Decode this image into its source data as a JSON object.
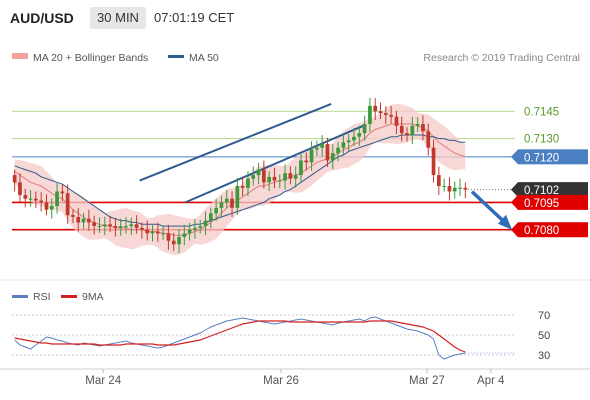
{
  "header": {
    "symbol": "AUD/USD",
    "timeframe": "30 MIN",
    "time": "07:01:19 CET"
  },
  "legend": {
    "ma20_bollinger": "MA 20 + Bollinger Bands",
    "ma50": "MA 50",
    "copyright": "Research © 2019 Trading Central"
  },
  "rsi_legend": {
    "rsi": "RSI",
    "ma9": "9MA"
  },
  "colors": {
    "bull": "#3a9a3a",
    "bear": "#c0392b",
    "band": "#f6c9c9",
    "ma20": "#e07b7b",
    "ma50": "#2e5c8a",
    "trend": "#2f5b91",
    "green_level": "#b5d98a",
    "blue_level": "#4a7fc1",
    "red_level": "#e00000",
    "current": "#333333",
    "arrow": "#2f6db5",
    "rsi": "#5a7fc0",
    "rsi_ma": "#d42020"
  },
  "chart_data": [
    {
      "type": "candlestick",
      "title": "AUD/USD 30 MIN",
      "x_ticks": [
        "Mar 24",
        "Mar 26",
        "Mar 27",
        "Apr 4"
      ],
      "ylim": [
        0.7059,
        0.7166
      ],
      "levels": [
        {
          "label": "0.7145",
          "value": 0.7145,
          "style": "green"
        },
        {
          "label": "0.7130",
          "value": 0.713,
          "style": "green"
        },
        {
          "label": "0.7120",
          "value": 0.712,
          "style": "blue"
        },
        {
          "label": "0.7102",
          "value": 0.7102,
          "style": "current"
        },
        {
          "label": "0.7095",
          "value": 0.7095,
          "style": "red"
        },
        {
          "label": "0.7080",
          "value": 0.708,
          "style": "red"
        }
      ],
      "close": [
        0.7106,
        0.7099,
        0.7097,
        0.7097,
        0.7096,
        0.7095,
        0.7091,
        0.7093,
        0.7101,
        0.71,
        0.7088,
        0.7087,
        0.7084,
        0.7086,
        0.7084,
        0.7082,
        0.7082,
        0.7083,
        0.7082,
        0.7081,
        0.7082,
        0.7082,
        0.7083,
        0.7081,
        0.708,
        0.7078,
        0.7079,
        0.7078,
        0.7078,
        0.7074,
        0.7072,
        0.7076,
        0.7078,
        0.708,
        0.7081,
        0.7082,
        0.7085,
        0.7089,
        0.7092,
        0.7095,
        0.7097,
        0.7092,
        0.7104,
        0.7103,
        0.7108,
        0.711,
        0.7113,
        0.7106,
        0.7109,
        0.7107,
        0.7107,
        0.7111,
        0.7108,
        0.711,
        0.7118,
        0.7117,
        0.7124,
        0.7125,
        0.7127,
        0.7118,
        0.7122,
        0.7125,
        0.7128,
        0.7129,
        0.7131,
        0.7133,
        0.7138,
        0.7148,
        0.7145,
        0.7144,
        0.7143,
        0.7142,
        0.7137,
        0.7133,
        0.7132,
        0.7137,
        0.7138,
        0.7134,
        0.7125,
        0.711,
        0.7104,
        0.7104,
        0.7101,
        0.7103,
        0.7103,
        0.7102
      ],
      "ma20": [
        0.7112,
        0.711,
        0.7108,
        0.7106,
        0.7105,
        0.7104,
        0.7102,
        0.71,
        0.7098,
        0.7097,
        0.7094,
        0.7091,
        0.7089,
        0.7087,
        0.7085,
        0.7084,
        0.7083,
        0.7082,
        0.7082,
        0.7081,
        0.7081,
        0.7081,
        0.708,
        0.708,
        0.708,
        0.7079,
        0.7079,
        0.7079,
        0.7078,
        0.7078,
        0.7077,
        0.7077,
        0.7077,
        0.7078,
        0.7079,
        0.708,
        0.7082,
        0.7084,
        0.7086,
        0.7089,
        0.7092,
        0.7094,
        0.7096,
        0.7098,
        0.71,
        0.7102,
        0.7104,
        0.7104,
        0.7105,
        0.7106,
        0.7107,
        0.7108,
        0.7109,
        0.711,
        0.7111,
        0.7113,
        0.7115,
        0.7117,
        0.7118,
        0.7119,
        0.712,
        0.7122,
        0.7124,
        0.7125,
        0.7127,
        0.7128,
        0.713,
        0.7133,
        0.7135,
        0.7136,
        0.7137,
        0.7138,
        0.7138,
        0.7138,
        0.7138,
        0.7138,
        0.7137,
        0.7136,
        0.7134,
        0.7131,
        0.7128,
        0.7126,
        0.7124,
        0.7122,
        0.7121,
        0.712
      ],
      "ma50": [
        0.7115,
        0.7114,
        0.7113,
        0.7112,
        0.7111,
        0.7109,
        0.7108,
        0.7107,
        0.7106,
        0.7105,
        0.7103,
        0.7101,
        0.7099,
        0.7097,
        0.7095,
        0.7093,
        0.7091,
        0.7089,
        0.7087,
        0.7086,
        0.7085,
        0.7085,
        0.7084,
        0.7084,
        0.7083,
        0.7083,
        0.7083,
        0.7083,
        0.7082,
        0.7082,
        0.7082,
        0.7082,
        0.7082,
        0.7082,
        0.7083,
        0.7083,
        0.7084,
        0.7085,
        0.7086,
        0.7087,
        0.7088,
        0.7089,
        0.709,
        0.7091,
        0.7092,
        0.7093,
        0.7094,
        0.7095,
        0.7097,
        0.7098,
        0.7099,
        0.7101,
        0.7102,
        0.7104,
        0.7106,
        0.7108,
        0.711,
        0.7112,
        0.7114,
        0.7116,
        0.7118,
        0.712,
        0.7121,
        0.7123,
        0.7124,
        0.7125,
        0.7126,
        0.7127,
        0.7128,
        0.7129,
        0.713,
        0.7131,
        0.7131,
        0.7132,
        0.7132,
        0.7132,
        0.7132,
        0.7132,
        0.7131,
        0.7131,
        0.713,
        0.713,
        0.7129,
        0.7129,
        0.7128,
        0.7128
      ],
      "bb_width": 0.0011,
      "channel_upper": [
        [
          0.28,
          0.7107
        ],
        [
          0.7,
          0.7149
        ]
      ],
      "channel_lower": [
        [
          0.38,
          0.7095
        ],
        [
          0.77,
          0.7137
        ]
      ],
      "forecast_arrow": [
        [
          0.7102,
          "0.7102"
        ],
        [
          0.708,
          "0.7080"
        ]
      ]
    },
    {
      "type": "line",
      "title": "RSI",
      "ylim": [
        20,
        80
      ],
      "y_ticks": [
        70,
        50,
        30
      ],
      "series": [
        {
          "name": "RSI",
          "values": [
            45,
            40,
            38,
            36,
            40,
            44,
            48,
            47,
            45,
            44,
            42,
            41,
            40,
            42,
            41,
            40,
            39,
            40,
            41,
            42,
            43,
            44,
            42,
            41,
            40,
            39,
            38,
            37,
            38,
            40,
            42,
            44,
            46,
            48,
            50,
            52,
            55,
            58,
            60,
            62,
            64,
            65,
            66,
            67,
            66,
            65,
            64,
            63,
            62,
            61,
            62,
            63,
            64,
            65,
            66,
            65,
            64,
            63,
            62,
            61,
            60,
            62,
            63,
            64,
            65,
            66,
            64,
            67,
            68,
            66,
            64,
            62,
            60,
            58,
            56,
            55,
            54,
            52,
            50,
            46,
            30,
            26,
            28,
            30,
            31,
            32
          ]
        },
        {
          "name": "9MA",
          "values": [
            47,
            46,
            45,
            44,
            43,
            42,
            42,
            41,
            41,
            41,
            41,
            41,
            41,
            41,
            41,
            41,
            40,
            40,
            40,
            40,
            40,
            41,
            41,
            41,
            41,
            41,
            41,
            40,
            40,
            40,
            40,
            41,
            42,
            43,
            44,
            45,
            47,
            49,
            51,
            53,
            55,
            57,
            59,
            61,
            62,
            63,
            64,
            64,
            64,
            64,
            64,
            64,
            63,
            63,
            63,
            63,
            63,
            63,
            63,
            63,
            63,
            63,
            63,
            63,
            63,
            63,
            63,
            64,
            64,
            64,
            64,
            64,
            63,
            62,
            61,
            60,
            59,
            58,
            56,
            54,
            50,
            46,
            42,
            38,
            35,
            33
          ]
        }
      ]
    }
  ]
}
